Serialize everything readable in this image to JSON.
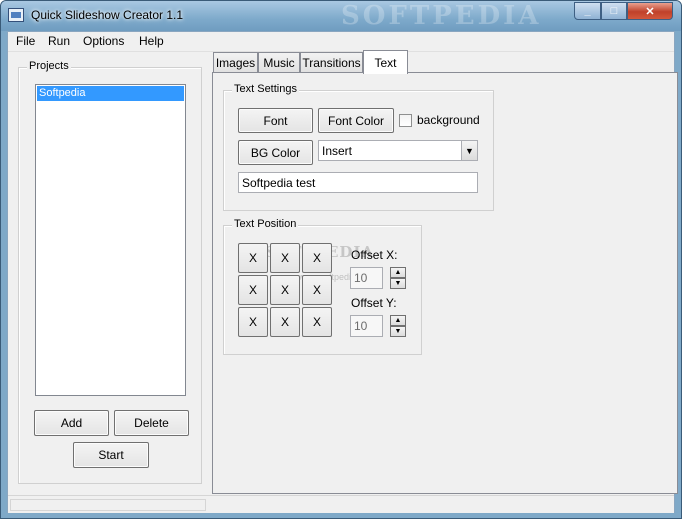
{
  "titlebar": {
    "title": "Quick Slideshow Creator 1.1",
    "watermark": "SOFTPEDIA",
    "min": "_",
    "max": "□",
    "close": "✕"
  },
  "menu": {
    "file": "File",
    "run": "Run",
    "options": "Options",
    "help": "Help"
  },
  "projects": {
    "group_title": "Projects",
    "items": [
      "Softpedia"
    ],
    "add_label": "Add",
    "delete_label": "Delete",
    "start_label": "Start"
  },
  "tabs": [
    {
      "label": "Images"
    },
    {
      "label": "Music"
    },
    {
      "label": "Transitions"
    },
    {
      "label": "Text"
    }
  ],
  "active_tab": "Text",
  "text_settings": {
    "group_title": "Text Settings",
    "font_label": "Font",
    "font_color_label": "Font Color",
    "background_label": "background",
    "background_checked": false,
    "bg_color_label": "BG Color",
    "mode_value": "Insert",
    "text_value": "Softpedia test"
  },
  "text_position": {
    "group_title": "Text Position",
    "grid": [
      "X",
      "X",
      "X",
      "X",
      "X",
      "X",
      "X",
      "X",
      "X"
    ],
    "offset_x_label": "Offset X:",
    "offset_x_value": "10",
    "offset_y_label": "Offset Y:",
    "offset_y_value": "10",
    "watermark": "SOFTPEDIA",
    "watermark_url": "www.softpedia.com"
  },
  "colors": {
    "selection": "#3399ff",
    "window_bg": "#f0f0f0",
    "frame": "#7fa9c8"
  }
}
